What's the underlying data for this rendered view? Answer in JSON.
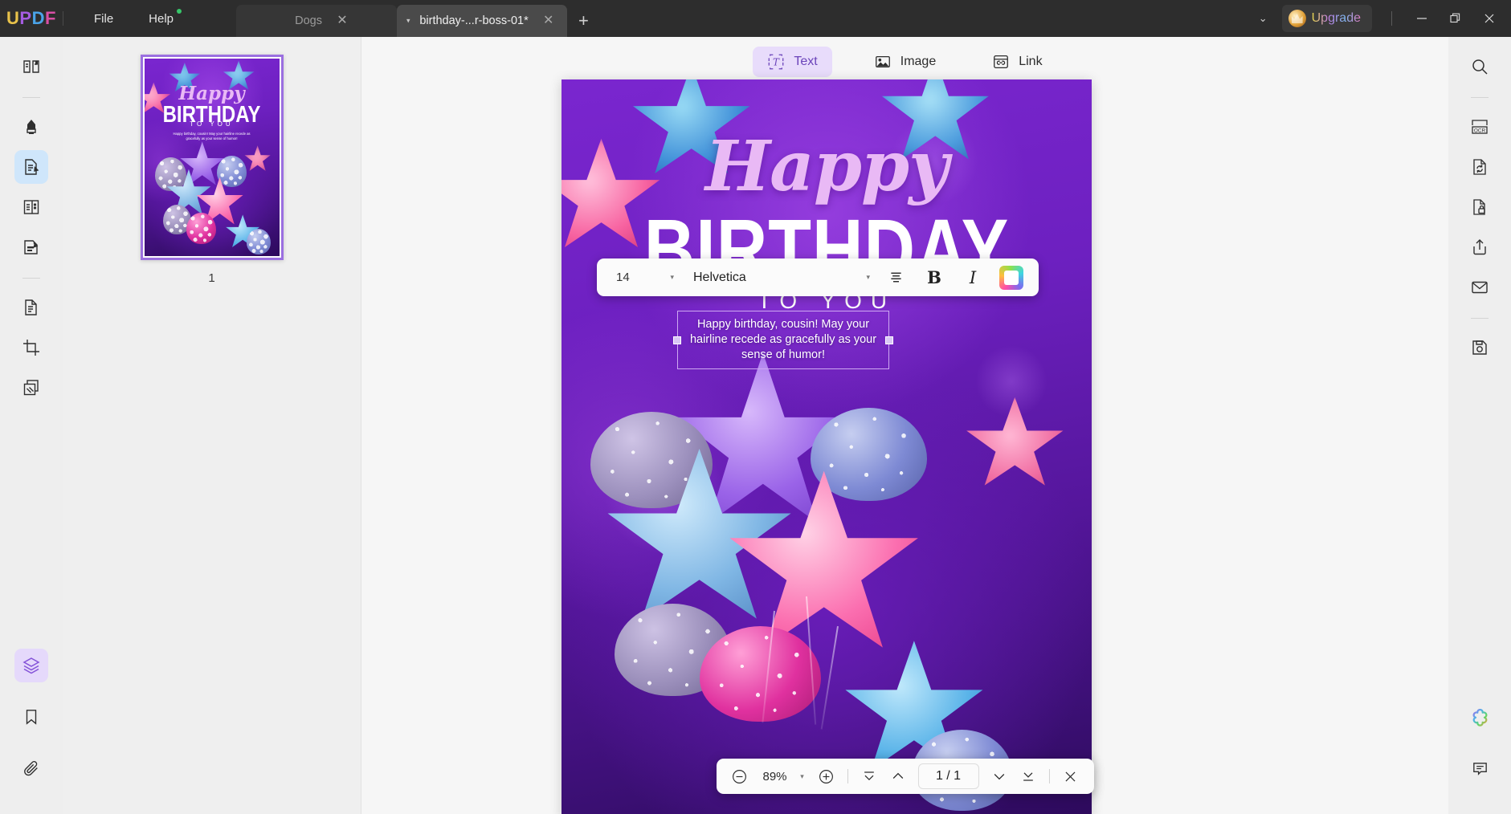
{
  "app": {
    "logo": "UPDF",
    "logo_parts": [
      "U",
      "P",
      "D",
      "F"
    ]
  },
  "menu": [
    {
      "label": "File",
      "badge": false
    },
    {
      "label": "Help",
      "badge": true
    }
  ],
  "tabs": [
    {
      "label": "Dogs",
      "active": false,
      "close": "✕"
    },
    {
      "label": "birthday-...r-boss-01*",
      "active": true,
      "close": "✕"
    }
  ],
  "tab_new_label": "+",
  "titlebar": {
    "overflow_caret": "⌄",
    "upgrade_label": "Upgrade",
    "minimize": "—",
    "restore": "❐",
    "close": "✕"
  },
  "left_rail": {
    "items": [
      {
        "name": "reader-icon",
        "label": "Reader",
        "state": "normal"
      },
      {
        "name": "annotate-highlighter-icon",
        "label": "Annotate",
        "state": "normal"
      },
      {
        "name": "edit-pdf-icon",
        "label": "Edit PDF",
        "state": "active"
      },
      {
        "name": "page-form-icon",
        "label": "Form",
        "state": "normal"
      },
      {
        "name": "fill-sign-icon",
        "label": "Fill & Sign",
        "state": "normal"
      },
      {
        "name": "organize-pages-icon",
        "label": "Organize Pages",
        "state": "normal"
      },
      {
        "name": "crop-page-icon",
        "label": "Crop",
        "state": "normal"
      },
      {
        "name": "batch-process-icon",
        "label": "Batch",
        "state": "normal"
      }
    ],
    "bottom_items": [
      {
        "name": "layers-icon",
        "label": "Layers",
        "state": "active-purple"
      },
      {
        "name": "bookmark-icon",
        "label": "Bookmark",
        "state": "normal"
      },
      {
        "name": "attachment-icon",
        "label": "Attachment",
        "state": "normal"
      }
    ]
  },
  "right_rail": {
    "items": [
      {
        "name": "search-icon",
        "label": "Search"
      },
      {
        "name": "ocr-icon",
        "label": "OCR"
      },
      {
        "name": "convert-icon",
        "label": "Convert"
      },
      {
        "name": "protect-icon",
        "label": "Protect"
      },
      {
        "name": "share-icon",
        "label": "Share"
      },
      {
        "name": "mail-icon",
        "label": "Email"
      },
      {
        "name": "save-icon",
        "label": "Save"
      }
    ],
    "bottom_items": [
      {
        "name": "ai-assistant-icon",
        "label": "AI Assistant"
      },
      {
        "name": "comment-icon",
        "label": "Comment"
      }
    ]
  },
  "thumbnails": {
    "pages": [
      {
        "number": "1",
        "selected": true
      }
    ]
  },
  "modebar": {
    "buttons": [
      {
        "label": "Text",
        "icon": "text-edit-icon",
        "selected": true
      },
      {
        "label": "Image",
        "icon": "image-edit-icon",
        "selected": false
      },
      {
        "label": "Link",
        "icon": "link-edit-icon",
        "selected": false
      }
    ]
  },
  "font_toolbar": {
    "font_size": "14",
    "font_family": "Helvetica",
    "align_icon": "align-center-icon",
    "bold_label": "B",
    "italic_label": "I",
    "color_icon": "font-color-icon",
    "size_caret": "▾",
    "family_caret": "▾"
  },
  "document": {
    "headline_script": "Happy",
    "headline_block": "BIRTHDAY",
    "headline_sub": "TO YOU",
    "textbox_value": "Happy birthday, cousin! May your hairline recede as gracefully as your sense of humor!"
  },
  "page_toolbar": {
    "zoom_out": "−",
    "zoom_value": "89%",
    "zoom_caret": "▾",
    "zoom_in": "+",
    "first_page": "first-page-icon",
    "prev_page": "prev-page-icon",
    "page_indicator": "1 / 1",
    "next_page": "next-page-icon",
    "last_page": "last-page-icon",
    "close": "✕"
  },
  "colors": {
    "titlebar_bg": "#2d2d2d",
    "rail_bg": "#eeeeee",
    "canvas_bg": "#f6f6f6",
    "accent_purple": "#6b44ba",
    "selection_purple": "#9b6fe0",
    "page_purple": "#6a1fc4"
  }
}
